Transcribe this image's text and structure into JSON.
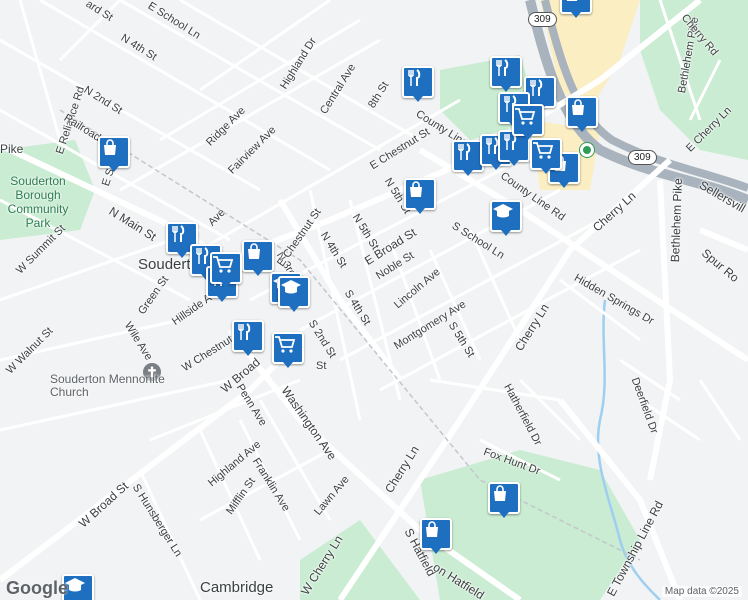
{
  "map": {
    "places": {
      "souderton": "Souderton",
      "cambridge": "Cambridge"
    },
    "parks": {
      "community_park": "Souderton Borough Community Park"
    },
    "church": {
      "label": "Souderton Mennonite Church"
    },
    "route_shield_1": "309",
    "route_shield_2": "309",
    "streets": {
      "e_school_ln": "E School Ln",
      "n_4th_st_nw": "N 4th St",
      "highland_dr": "Highland Dr",
      "central_ave": "Central Ave",
      "8th_st": "8th St",
      "e_reliance_rd": "E Reliance Rd",
      "n_2nd_st": "N 2nd St",
      "railroad_ave": "Railroad Ave",
      "ridge_ave": "Ridge Ave",
      "fairview_ave": "Fairview Ave",
      "e_chestnut_st_n": "E Chestnut St",
      "county_line_rd": "County Line Rd",
      "county_line_rd_e": "County Line Rd",
      "n_5th_st_n": "N 5th St",
      "n_5th_st": "N 5th St",
      "n_4th_st": "N 4th St",
      "n_3rd_st": "N 3rd St",
      "e_chestnut_st": "E Chestnut St",
      "e_broad_st": "E Broad St",
      "noble_st": "Noble St",
      "s_school_ln": "S School Ln",
      "lincoln_ave": "Lincoln Ave",
      "montgomery_ave": "Montgomery Ave",
      "s_5th_st": "S 5th St",
      "s_4th_st": "S 4th St",
      "s_2nd_st": "S 2nd St",
      "n_main_st": "N Main St",
      "w_summit_st": "W Summit St",
      "green_st": "Green St",
      "hillside_ave": "Hillside Ave",
      "wile_ave": "Wile Ave",
      "w_walnut_st": "W Walnut St",
      "w_chestnut_st": "W Chestnut St",
      "w_broad": "W Broad",
      "penn_ave": "Penn Ave",
      "washington_ave": "Washington Ave",
      "highland_ave": "Highland Ave",
      "franklin_ave": "Franklin Ave",
      "mifflin_st": "Mifflin St",
      "w_broad_st": "W Broad St",
      "s_hunsberger_ln": "S Hunsberger Ln",
      "lawn_ave": "Lawn Ave",
      "cherry_ln_s": "Cherry Ln",
      "w_cherry_ln": "W Cherry Ln",
      "cherry_ln": "Cherry Ln",
      "cherry_ln_e": "Cherry Ln",
      "hidden_springs_dr": "Hidden Springs Dr",
      "hatherfield_dr": "Hatherfield Dr",
      "fox_hunt_dr": "Fox Hunt Dr",
      "deerfield_dr": "Deerfield Dr",
      "s_hatfield": "S Hatfield",
      "e_township_line_rd": "E Township Line Rd",
      "bethlehem_pike": "Bethlehem Pike",
      "bethlehem_pike_n": "Bethlehem Pike",
      "cherry_rd": "Cherry Rd",
      "e_cherry_ln": "E Cherry Ln",
      "sellersville": "Sellersvill",
      "spur_rd": "Spur Ro",
      "pike": "Pike",
      "e_sb": "E S",
      "ave_frag": "Ave",
      "souder_frag": "Souder",
      "ard_st": "ard St",
      "st_frag": "St",
      "on_hatfield": "on Hatfield"
    },
    "pois": [
      {
        "type": "shopping",
        "icon": "shopping-bag-icon"
      },
      {
        "type": "shopping",
        "icon": "shopping-bag-icon"
      },
      {
        "type": "shopping",
        "icon": "shopping-bag-icon"
      },
      {
        "type": "shopping",
        "icon": "shopping-bag-icon"
      },
      {
        "type": "shopping",
        "icon": "shopping-bag-icon"
      },
      {
        "type": "shopping",
        "icon": "shopping-bag-icon"
      },
      {
        "type": "shopping",
        "icon": "shopping-bag-icon"
      },
      {
        "type": "shopping",
        "icon": "shopping-bag-icon"
      },
      {
        "type": "restaurant",
        "icon": "fork-knife-icon"
      },
      {
        "type": "restaurant",
        "icon": "fork-knife-icon"
      },
      {
        "type": "restaurant",
        "icon": "fork-knife-icon"
      },
      {
        "type": "restaurant",
        "icon": "fork-knife-icon"
      },
      {
        "type": "restaurant",
        "icon": "fork-knife-icon"
      },
      {
        "type": "restaurant",
        "icon": "fork-knife-icon"
      },
      {
        "type": "restaurant",
        "icon": "fork-knife-icon"
      },
      {
        "type": "restaurant",
        "icon": "fork-knife-icon"
      },
      {
        "type": "restaurant",
        "icon": "fork-knife-icon"
      },
      {
        "type": "restaurant",
        "icon": "fork-knife-icon"
      },
      {
        "type": "restaurant",
        "icon": "fork-knife-icon"
      },
      {
        "type": "grocery",
        "icon": "shopping-cart-icon"
      },
      {
        "type": "grocery",
        "icon": "shopping-cart-icon"
      },
      {
        "type": "grocery",
        "icon": "shopping-cart-icon"
      },
      {
        "type": "grocery",
        "icon": "shopping-cart-icon"
      },
      {
        "type": "school",
        "icon": "graduation-cap-icon"
      },
      {
        "type": "school",
        "icon": "graduation-cap-icon"
      },
      {
        "type": "school",
        "icon": "graduation-cap-icon"
      },
      {
        "type": "school",
        "icon": "graduation-cap-icon"
      }
    ],
    "attribution": "Map data ©2025",
    "logo": "Google"
  }
}
